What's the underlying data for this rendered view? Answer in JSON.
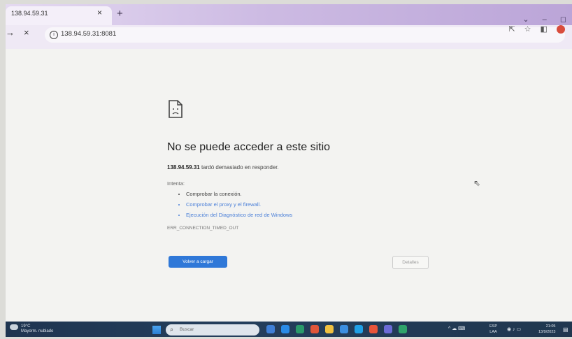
{
  "browser": {
    "tab_title": "138.94.59.31",
    "tab_close": "×",
    "new_tab": "+",
    "back": "→",
    "reload_stop": "×",
    "url": "138.94.59.31:8081",
    "window_controls": [
      "⌄",
      "–",
      "◻"
    ]
  },
  "error_page": {
    "title": "No se puede acceder a este sitio",
    "host": "138.94.59.31",
    "description_suffix": " tardó demasiado en responder.",
    "try_label": "Intenta:",
    "suggestions": [
      {
        "text": "Comprobar la conexión.",
        "link": false
      },
      {
        "text": "Comprobar el proxy y el firewall.",
        "link": true
      },
      {
        "text": "Ejecución del Diagnóstico de red de Windows",
        "link": true
      }
    ],
    "error_code": "ERR_CONNECTION_TIMED_OUT",
    "reload_button": "Volver a cargar",
    "details_button": "Detalles"
  },
  "taskbar": {
    "temperature": "19°C",
    "weather_text": "Mayorm. nublado",
    "search_placeholder": "Buscar",
    "language_top": "ESP",
    "language_bottom": "LAA",
    "time": "21:05",
    "date": "13/9/2023",
    "app_colors": [
      "#3f7fd6",
      "#2a8be6",
      "#2a9a6a",
      "#e0563a",
      "#f0c040",
      "#3b8ee0",
      "#1fa0e6",
      "#e8543a",
      "#6b6bd6",
      "#2fa46b"
    ]
  }
}
